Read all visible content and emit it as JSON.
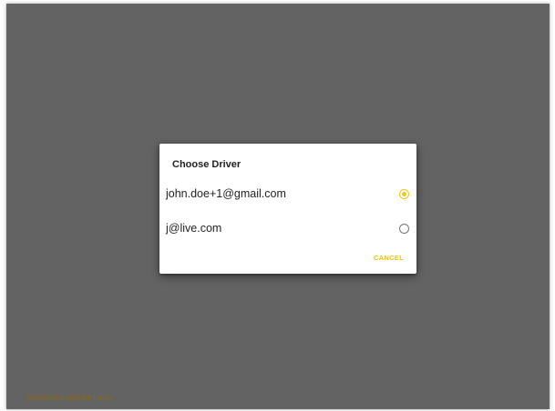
{
  "dialog": {
    "title": "Choose Driver",
    "options": [
      {
        "label": "john.doe+1@gmail.com",
        "selected": true
      },
      {
        "label": "j@live.com",
        "selected": false
      }
    ],
    "cancel_label": "CANCEL"
  },
  "footer": {
    "brand_text": "ACCESSCO-DRIVER LOGS"
  },
  "colors": {
    "accent": "#f5c518",
    "overlay": "#636363"
  }
}
